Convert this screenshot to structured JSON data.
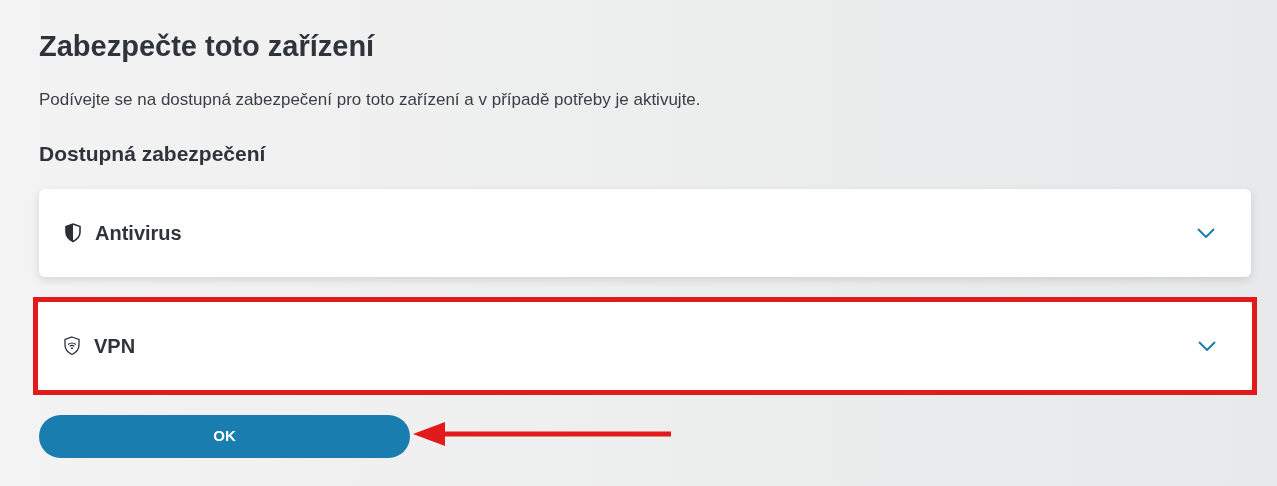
{
  "title": "Zabezpečte toto zařízení",
  "description": "Podívejte se na dostupná zabezpečení pro toto zařízení a v případě potřeby je aktivujte.",
  "section_title": "Dostupná zabezpečení",
  "items": [
    {
      "kind": "antivirus",
      "label": "Antivirus",
      "expanded": false,
      "highlighted": false
    },
    {
      "kind": "vpn",
      "label": "VPN",
      "expanded": false,
      "highlighted": true
    }
  ],
  "ok_button": {
    "label": "OK",
    "arrow": true
  }
}
